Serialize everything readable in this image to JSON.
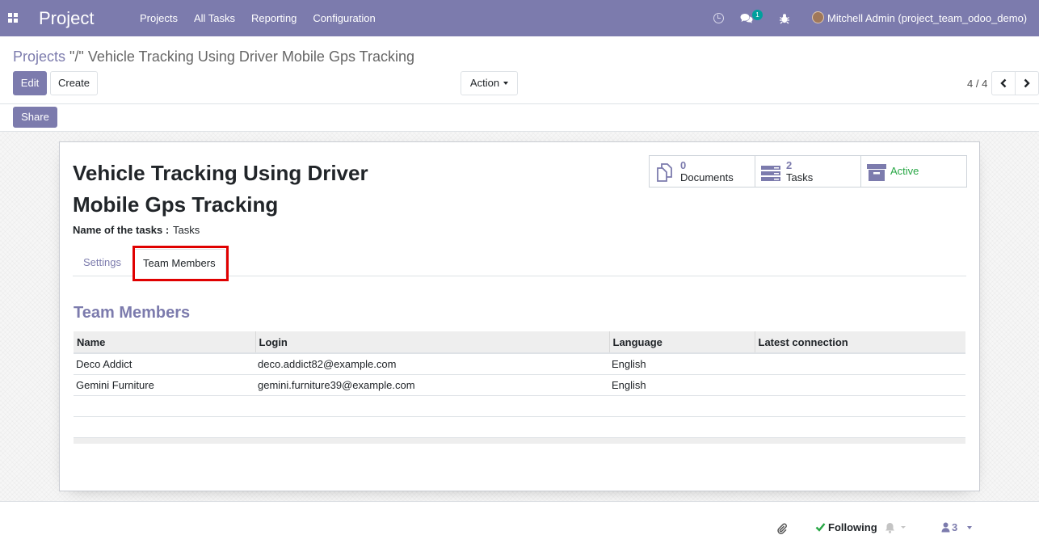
{
  "navbar": {
    "brand": "Project",
    "menu": [
      "Projects",
      "All Tasks",
      "Reporting",
      "Configuration"
    ],
    "chat_badge": "1",
    "user": "Mitchell Admin (project_team_odoo_demo)"
  },
  "control_panel": {
    "breadcrumb_link": "Projects",
    "breadcrumb_sep": " \"/\" ",
    "breadcrumb_current": "Vehicle Tracking Using Driver Mobile Gps Tracking",
    "edit_label": "Edit",
    "create_label": "Create",
    "action_label": "Action",
    "pager": "4 / 4"
  },
  "statusbar": {
    "share_label": "Share"
  },
  "form": {
    "title": "Vehicle Tracking Using Driver Mobile Gps Tracking",
    "smart_buttons": {
      "documents_count": "0",
      "documents_label": "Documents",
      "tasks_count": "2",
      "tasks_label": "Tasks",
      "active_label": "Active"
    },
    "tasks_name_label": "Name of the tasks :",
    "tasks_name_value": "Tasks",
    "tabs": [
      "Settings",
      "Team Members"
    ],
    "section_title": "Team Members",
    "table": {
      "columns": [
        "Name",
        "Login",
        "Language",
        "Latest connection"
      ],
      "rows": [
        [
          "Deco Addict",
          "deco.addict82@example.com",
          "English",
          ""
        ],
        [
          "Gemini Furniture",
          "gemini.furniture39@example.com",
          "English",
          ""
        ]
      ]
    }
  },
  "chatter": {
    "following_label": "Following",
    "followers_count": "3"
  },
  "colors": {
    "brand": "#7c7bad",
    "active": "#28a745",
    "highlight": "#e00000",
    "badge": "#00a09d"
  }
}
